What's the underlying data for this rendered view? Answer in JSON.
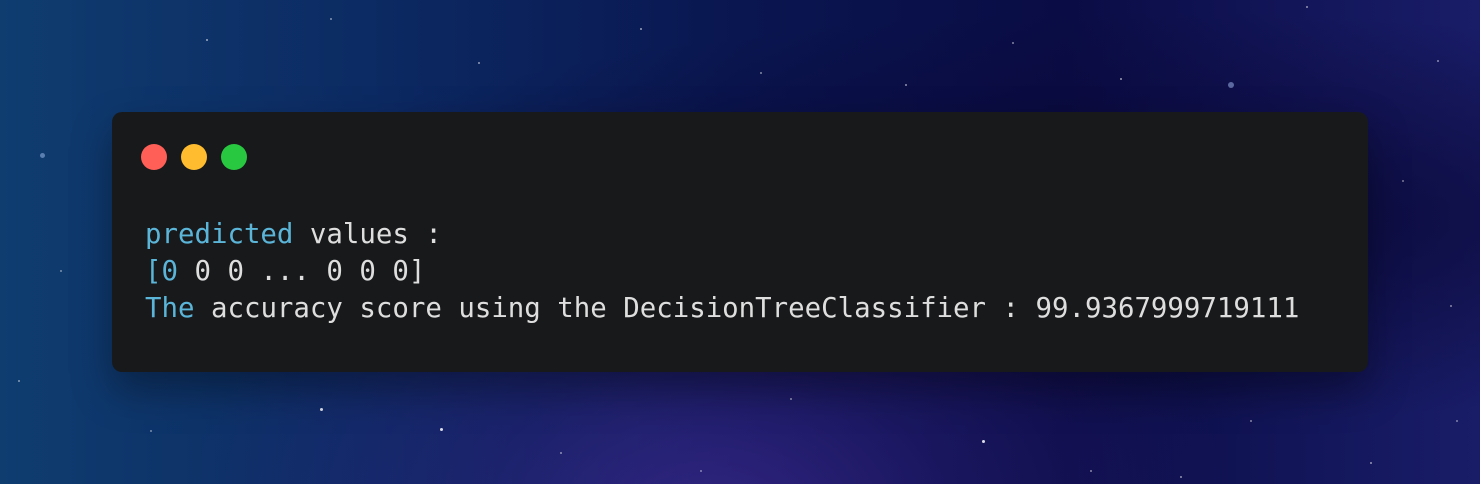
{
  "window": {
    "controls": {
      "close_color": "#ff5f57",
      "minimize_color": "#febc2e",
      "maximize_color": "#28c840"
    },
    "background_color": "#18191b"
  },
  "output": {
    "line1": {
      "keyword": "predicted",
      "rest": " values :"
    },
    "line2": {
      "bracket_open": "[0",
      "rest": " 0 0 ... 0 0 0]"
    },
    "line3": {
      "keyword": "The",
      "rest": " accuracy score using the DecisionTreeClassifier : 99.9367999719111"
    }
  },
  "colors": {
    "keyword": "#5bb5d8",
    "text": "#dedede"
  }
}
